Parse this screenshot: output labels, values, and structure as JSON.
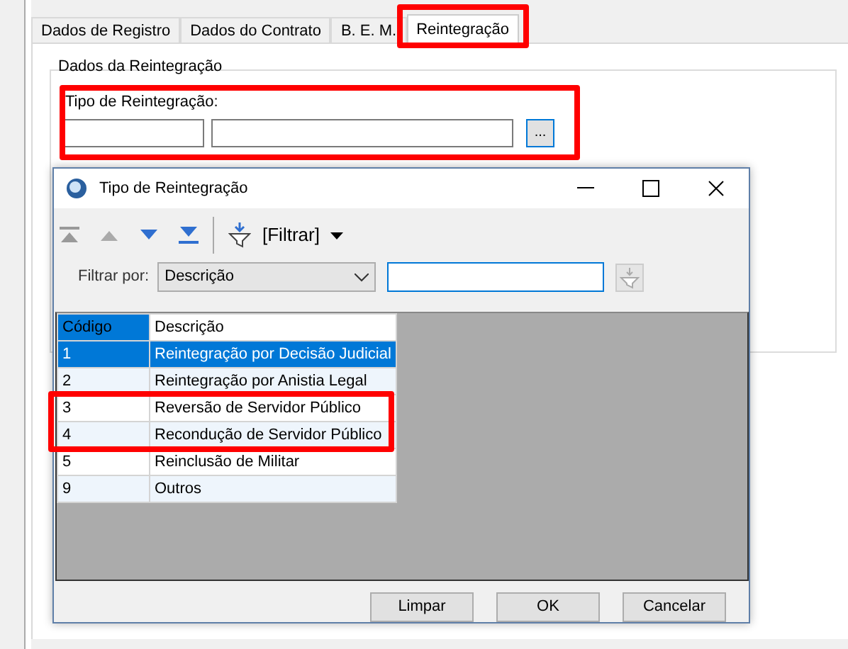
{
  "tabs": [
    {
      "label": "Dados de Registro",
      "selected": false
    },
    {
      "label": "Dados do Contrato",
      "selected": false
    },
    {
      "label": "B. E. M.",
      "selected": false
    },
    {
      "label": "Reintegração",
      "selected": true
    }
  ],
  "group": {
    "title": "Dados da Reintegração",
    "field_label": "Tipo de Reintegração:",
    "lookup_button": "..."
  },
  "dialog": {
    "title": "Tipo de Reintegração",
    "toolbar": {
      "filter_button": "[Filtrar]"
    },
    "filter": {
      "label": "Filtrar por:",
      "field": "Descrição"
    },
    "table": {
      "columns": [
        "Código",
        "Descrição"
      ],
      "rows": [
        {
          "cells": [
            "1",
            "Reintegração por Decisão Judicial"
          ],
          "selected": true
        },
        {
          "cells": [
            "2",
            "Reintegração por Anistia Legal"
          ],
          "selected": false
        },
        {
          "cells": [
            "3",
            "Reversão de Servidor Público"
          ],
          "selected": false
        },
        {
          "cells": [
            "4",
            "Recondução de Servidor Público"
          ],
          "selected": false
        },
        {
          "cells": [
            "5",
            "Reinclusão de Militar"
          ],
          "selected": false
        },
        {
          "cells": [
            "9",
            "Outros"
          ],
          "selected": false
        }
      ]
    },
    "buttons": [
      "Limpar",
      "OK",
      "Cancelar"
    ]
  }
}
